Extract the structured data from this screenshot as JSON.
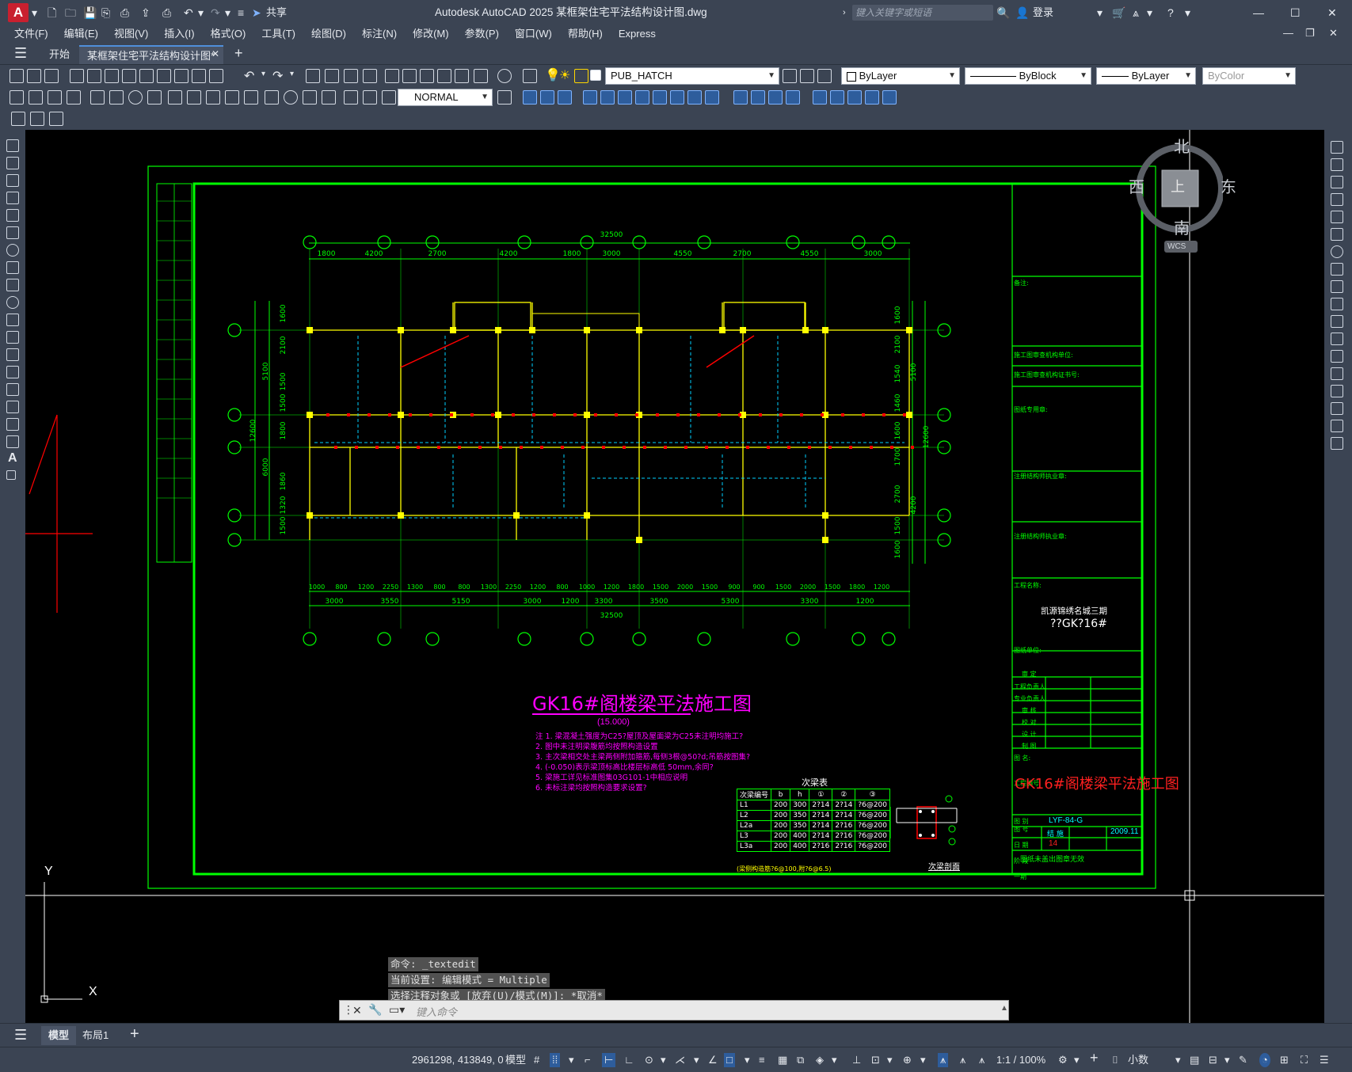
{
  "window": {
    "title": "Autodesk AutoCAD 2025    某框架住宅平法结构设计图.dwg",
    "share": "共享",
    "search_placeholder": "键入关键字或短语",
    "login": "登录"
  },
  "menus": [
    "文件(F)",
    "编辑(E)",
    "视图(V)",
    "插入(I)",
    "格式(O)",
    "工具(T)",
    "绘图(D)",
    "标注(N)",
    "修改(M)",
    "参数(P)",
    "窗口(W)",
    "帮助(H)",
    "Express"
  ],
  "tabs": {
    "start": "开始",
    "doc": "某框架住宅平法结构设计图*"
  },
  "toolbar": {
    "layer": "PUB_HATCH",
    "color": "ByLayer",
    "linetype": "ByBlock",
    "lineweight": "ByLayer",
    "plotstyle": "ByColor",
    "dimstyle": "NORMAL"
  },
  "viewcube": {
    "north": "北",
    "south": "南",
    "east": "东",
    "west": "西",
    "top": "上",
    "wcs": "WCS"
  },
  "command": {
    "lines": [
      "命令: _textedit",
      "当前设置: 编辑模式 = Multiple",
      "选择注释对象或 [放弃(U)/模式(M)]: *取消*"
    ],
    "placeholder": "键入命令"
  },
  "layout_tabs": {
    "model": "模型",
    "layout1": "布局1"
  },
  "status": {
    "coords": "2961298, 413849, 0",
    "model": "模型",
    "scale": "1:1 / 100%",
    "units": "小数"
  },
  "axis": {
    "y": "Y",
    "x": "X"
  },
  "drawing": {
    "title": "GK16#阁楼梁平法施工图",
    "elevation": "(15.000)",
    "top_total": "32500",
    "bottom_total": "32500",
    "top_dims": [
      "1800",
      "4200",
      "2700",
      "4200",
      "1800",
      "3000",
      "4550",
      "2700",
      "4550",
      "3000"
    ],
    "bottom_dims_1": [
      "1000",
      "800",
      "1200",
      "2250",
      "1300",
      "800",
      "800",
      "1300",
      "2250",
      "1200",
      "800",
      "1000",
      "1200",
      "1800",
      "1500",
      "2000",
      "1500",
      "900",
      "900",
      "1500",
      "2000",
      "1500",
      "1800",
      "1200"
    ],
    "bottom_dims_2": [
      "3000",
      "3550",
      "5150",
      "3000",
      "1200",
      "3300",
      "3500",
      "5300",
      "3300",
      "1200"
    ],
    "left_dims": [
      "1600",
      "2100",
      "1500",
      "1500",
      "1800",
      "1860",
      "1320",
      "1500"
    ],
    "left_totals": [
      "5100",
      "6000",
      "12600"
    ],
    "right_dims": [
      "1600",
      "2100",
      "1540",
      "1460",
      "1600",
      "1700",
      "2700",
      "1500",
      "1600"
    ],
    "right_totals": [
      "5100",
      "4200",
      "12600"
    ],
    "notes": [
      "注 1. 梁混凝土强度为C25?屋顶及屋面梁为C25未注明均施工?",
      "2. 图中未注明梁腹筋均按照构造设置",
      "3. 主次梁相交处主梁两侧附加箍筋,每侧3根@50?d;吊筋按图集?",
      "4. (-0.050)表示梁顶标高比楼层标高低 50mm,余同?",
      "5. 梁施工详见标准图集03G101-1中相应说明",
      "6. 未标注梁均按照构造要求设置?"
    ],
    "table": {
      "title": "次梁表",
      "headers": [
        "次梁编号",
        "b",
        "h",
        "①",
        "②",
        "③"
      ],
      "rows": [
        [
          "L1",
          "200",
          "300",
          "2?14",
          "2?14",
          "?6@200"
        ],
        [
          "L2",
          "200",
          "350",
          "2?14",
          "2?14",
          "?6@200"
        ],
        [
          "L2a",
          "200",
          "350",
          "2?14",
          "2?16",
          "?6@200"
        ],
        [
          "L3",
          "200",
          "400",
          "2?14",
          "2?16",
          "?6@200"
        ],
        [
          "L3a",
          "200",
          "400",
          "2?16",
          "2?16",
          "?6@200"
        ]
      ],
      "note": "(梁侧构造筋?6@100,附?6@6.5)"
    },
    "section_label": "次梁剖面",
    "title_block": {
      "project": "凯源锦绣名城三期",
      "building": "??GK?16#",
      "drawing_name": "GK16#阁楼梁平法施工图",
      "number": "LYF-84-G",
      "date": "2009.11",
      "sheet": "14",
      "phase": "结 施",
      "labels": [
        "备注:",
        "施工图审查机构单位:",
        "施工图审查机构证书号:",
        "图纸专用章:",
        "注册结构师执业章:",
        "注册结构师执业章:",
        "工程名称:",
        "图纸单位:",
        "审 定",
        "工程负责人",
        "专业负责人",
        "审 核",
        "校 对",
        "设 计",
        "制 图",
        "图 名:",
        "工程编号",
        "图 别",
        "图 号",
        "日 期",
        "阶 段",
        "一期"
      ],
      "footer": "图纸未盖出图章无效"
    }
  }
}
